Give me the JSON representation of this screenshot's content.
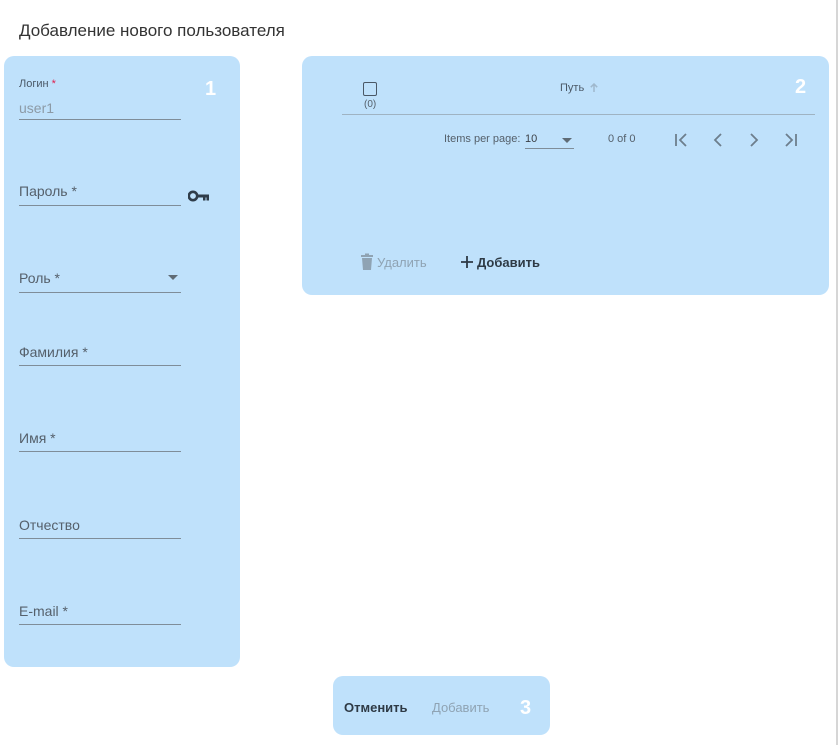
{
  "page": {
    "title": "Добавление нового пользователя"
  },
  "form_panel": {
    "number": "1",
    "login": {
      "label": "Логин",
      "required_mark": "*",
      "value": "user1"
    },
    "password": {
      "label": "Пароль *"
    },
    "role": {
      "label": "Роль *"
    },
    "last_name": {
      "label": "Фамилия *"
    },
    "first_name": {
      "label": "Имя *"
    },
    "middle_name": {
      "label": "Отчество"
    },
    "email": {
      "label": "E-mail *"
    }
  },
  "paths_panel": {
    "number": "2",
    "select_count": "(0)",
    "column_path": "Путь",
    "items_per_page_label": "Items per page:",
    "items_per_page_value": "10",
    "range_label": "0 of 0",
    "delete_label": "Удалить",
    "add_label": "Добавить"
  },
  "footer_panel": {
    "number": "3",
    "cancel_label": "Отменить",
    "submit_label": "Добавить"
  },
  "colors": {
    "panel_bg": "#bfe1fb",
    "text_dark": "#2e3a45",
    "text_disabled": "#8fa3b3",
    "required": "#e0204d"
  },
  "icons": [
    "key-icon",
    "chevron-down-icon",
    "sort-up-icon",
    "first-page-icon",
    "prev-page-icon",
    "next-page-icon",
    "last-page-icon",
    "trash-icon",
    "plus-icon"
  ]
}
